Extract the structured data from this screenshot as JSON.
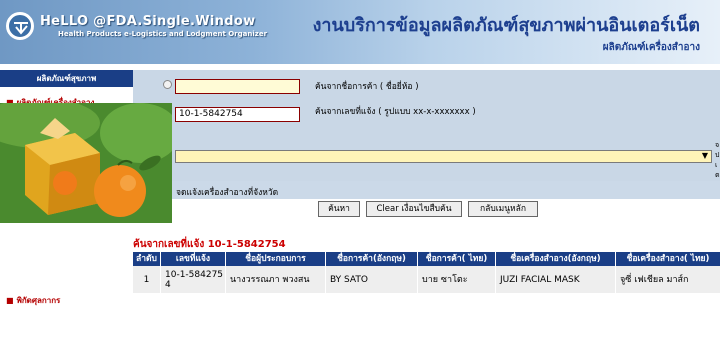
{
  "header": {
    "brand": "HeLLO @FDA.Single.Window",
    "brand_sub": "Health Products e-Logistics and Lodgment Organizer",
    "title": "งานบริการข้อมูลผลิตภัณฑ์สุขภาพผ่านอินเตอร์เน็ต",
    "subtitle": "ผลิตภัณฑ์เครื่องสำอาง"
  },
  "sidebar": {
    "heading": "ผลิตภัณฑ์สุขภาพ",
    "items": [
      {
        "label": "ผลิตภัณฑ์เครื่องสำอาง"
      },
      {
        "label": "พิกัดศุลกากร"
      }
    ]
  },
  "form": {
    "brand_input_value": "",
    "brand_label": "ค้นจากชื่อการค้า ( ชื่อยี่ห้อ )",
    "notify_input_value": "10-1-5842754",
    "notify_label": "ค้นจากเลขที่แจ้ง ( รูปแบบ xx-x-xxxxxxx )",
    "side_note": [
      "จ",
      "ป",
      "เ",
      "ต"
    ],
    "strip_label": "จดแจ้งเครื่องสำอางที่จังหวัด"
  },
  "buttons": {
    "search": "ค้นหา",
    "clear": "Clear เงื่อนไขสืบค้น",
    "back": "กลับเมนูหลัก"
  },
  "results": {
    "title": "ค้นจากเลขที่แจ้ง 10-1-5842754",
    "columns": [
      "ลำดับ",
      "เลขที่แจ้ง",
      "ชื่อผู้ประกอบการ",
      "ชื่อการค้า(อังกฤษ)",
      "ชื่อการค้า( ไทย)",
      "ชื่อเครื่องสำอาง(อังกฤษ)",
      "ชื่อเครื่องสำอาง( ไทย)"
    ],
    "rows": [
      [
        "1",
        "10-1-5842754",
        "นางวรรณภา พวงสน",
        "BY SATO",
        "บาย ซาโตะ",
        "JUZI FACIAL MASK",
        "จูซี่ เฟเชียล มาส์ก"
      ]
    ]
  }
}
